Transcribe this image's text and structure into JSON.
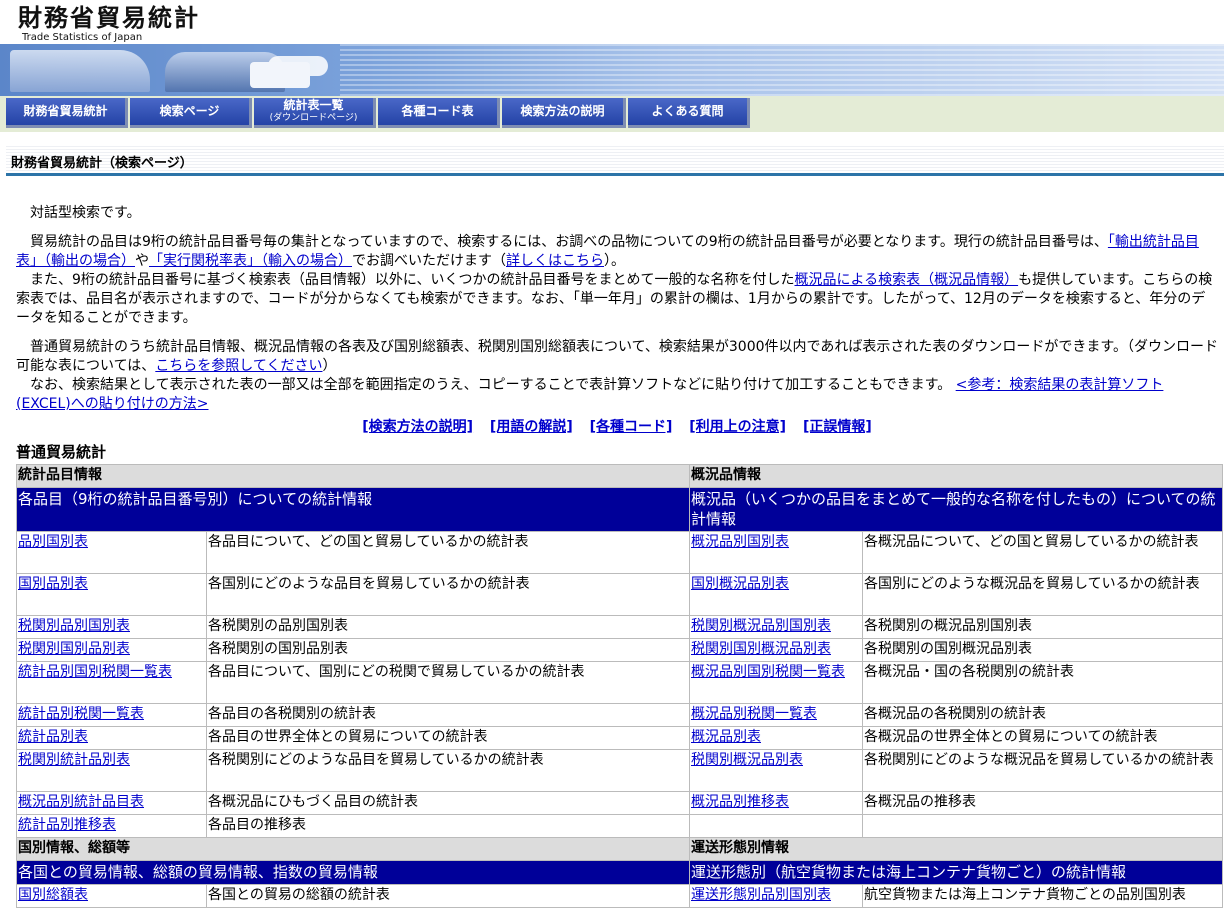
{
  "header": {
    "logo_title": "財務省貿易統計",
    "logo_subtitle": "Trade Statistics of Japan"
  },
  "nav": [
    {
      "label": "財務省貿易統計",
      "sub": ""
    },
    {
      "label": "検索ページ",
      "sub": ""
    },
    {
      "label": "統計表一覧",
      "sub": "(ダウンロードページ)"
    },
    {
      "label": "各種コード表",
      "sub": ""
    },
    {
      "label": "検索方法の説明",
      "sub": ""
    },
    {
      "label": "よくある質問",
      "sub": ""
    }
  ],
  "page_title": "財務省貿易統計（検索ページ）",
  "intro": {
    "p1": "対話型検索です。",
    "p2_a": "貿易統計の品目は9桁の統計品目番号毎の集計となっていますので、検索するには、お調べの品物についての9桁の統計品目番号が必要となります。現行の統計品目番号は、",
    "p2_link1": "「輸出統計品目表」（輸出の場合）",
    "p2_b": "や",
    "p2_link2": "「実行関税率表」（輸入の場合）",
    "p2_c": "でお調べいただけます（",
    "p2_link3": "詳しくはこちら",
    "p2_d": "）。",
    "p3_a": "また、9桁の統計品目番号に基づく検索表（品目情報）以外に、いくつかの統計品目番号をまとめて一般的な名称を付した",
    "p3_link": "概況品による検索表（概況品情報）",
    "p3_b": "も提供しています。こちらの検索表では、品目名が表示されますので、コードが分からなくても検索ができます。なお、「単一年月」の累計の欄は、1月からの累計です。したがって、12月のデータを検索すると、年分のデータを知ることができます。",
    "p4_a": "普通貿易統計のうち統計品目情報、概況品情報の各表及び国別総額表、税関別国別総額表について、検索結果が3000件以内であれば表示された表のダウンロードができます。（ダウンロード可能な表については、",
    "p4_link": "こちらを参照してください",
    "p4_b": "）",
    "p5_a": "なお、検索結果として表示された表の一部又は全部を範囲指定のうえ、コピーすることで表計算ソフトなどに貼り付けて加工することもできます。",
    "p5_link": "<参考：検索結果の表計算ソフト(EXCEL)への貼り付けの方法>"
  },
  "links": [
    "[検索方法の説明]",
    "[用語の解説]",
    "[各種コード]",
    "[利用上の注意]",
    "[正誤情報]"
  ],
  "section_title": "普通貿易統計",
  "table": {
    "left_header": "統計品目情報",
    "right_header": "概況品情報",
    "left_band": "各品目（9桁の統計品目番号別）についての統計情報",
    "right_band": "概況品（いくつかの品目をまとめて一般的な名称を付したもの）についての統計情報",
    "rows": [
      {
        "l_link": "品別国別表",
        "l_desc": "各品目について、どの国と貿易しているかの統計表",
        "r_link": "概況品別国別表",
        "r_desc": "各概況品について、どの国と貿易しているかの統計表"
      },
      {
        "l_link": "国別品別表",
        "l_desc": "各国別にどのような品目を貿易しているかの統計表",
        "r_link": "国別概況品別表",
        "r_desc": "各国別にどのような概況品を貿易しているかの統計表"
      },
      {
        "l_link": "税関別品別国別表",
        "l_desc": "各税関別の品別国別表",
        "r_link": "税関別概況品別国別表",
        "r_desc": "各税関別の概況品別国別表"
      },
      {
        "l_link": "税関別国別品別表",
        "l_desc": "各税関別の国別品別表",
        "r_link": "税関別国別概況品別表",
        "r_desc": "各税関別の国別概況品別表"
      },
      {
        "l_link": "統計品別国別税関一覧表",
        "l_desc": "各品目について、国別にどの税関で貿易しているかの統計表",
        "r_link": "概況品別国別税関一覧表",
        "r_desc": "各概況品・国の各税関別の統計表"
      },
      {
        "l_link": "統計品別税関一覧表",
        "l_desc": "各品目の各税関別の統計表",
        "r_link": "概況品別税関一覧表",
        "r_desc": "各概況品の各税関別の統計表"
      },
      {
        "l_link": "統計品別表",
        "l_desc": "各品目の世界全体との貿易についての統計表",
        "r_link": "概況品別表",
        "r_desc": "各概況品の世界全体との貿易についての統計表"
      },
      {
        "l_link": "税関別統計品別表",
        "l_desc": "各税関別にどのような品目を貿易しているかの統計表",
        "r_link": "税関別概況品別表",
        "r_desc": "各税関別にどのような概況品を貿易しているかの統計表"
      },
      {
        "l_link": "概況品別統計品目表",
        "l_desc": "各概況品にひもづく品目の統計表",
        "r_link": "概況品別推移表",
        "r_desc": "各概況品の推移表"
      },
      {
        "l_link": "統計品別推移表",
        "l_desc": "各品目の推移表",
        "r_link": "",
        "r_desc": ""
      }
    ],
    "left_header2": "国別情報、総額等",
    "right_header2": "運送形態別情報",
    "left_band2": "各国との貿易情報、総額の貿易情報、指数の貿易情報",
    "right_band2": "運送形態別（航空貨物または海上コンテナ貨物ごと）の統計情報",
    "row2": {
      "l_link": "国別総額表",
      "l_desc": "各国との貿易の総額の統計表",
      "r_link": "運送形態別品別国別表",
      "r_desc": "航空貨物または海上コンテナ貨物ごとの品別国別表"
    }
  }
}
